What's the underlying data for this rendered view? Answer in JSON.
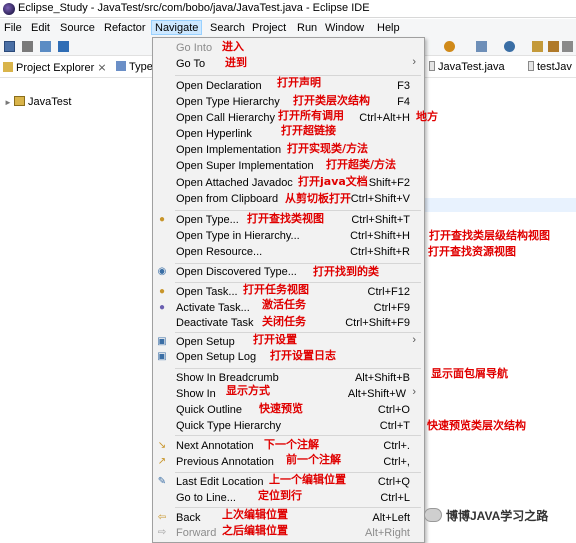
{
  "window": {
    "title": "Eclipse_Study - JavaTest/src/com/bobo/java/JavaTest.java - Eclipse IDE"
  },
  "menubar": {
    "items": [
      "File",
      "Edit",
      "Source",
      "Refactor",
      "Navigate",
      "Search",
      "Project",
      "Run",
      "Window",
      "Help"
    ]
  },
  "views": {
    "project_explorer": "Project Explorer",
    "type_hierarchy": "Type",
    "editor_tab_1": "JavaTest.java",
    "editor_tab_2": "testJav"
  },
  "tree": {
    "project": "JavaTest"
  },
  "navigate_menu": {
    "items": [
      {
        "label": "Go Into",
        "shortcut": "",
        "disabled": true,
        "annotation": "进入"
      },
      {
        "label": "Go To",
        "shortcut": "",
        "submenu": true,
        "annotation": "进到"
      },
      {
        "label": "Open Declaration",
        "shortcut": "F3",
        "annotation": "打开声明"
      },
      {
        "label": "Open Type Hierarchy",
        "shortcut": "F4",
        "annotation": "打开类层次结构"
      },
      {
        "label": "Open Call Hierarchy",
        "shortcut": "Ctrl+Alt+H",
        "annotation": "打开所有调用",
        "annotation_extra": "地方"
      },
      {
        "label": "Open Hyperlink",
        "shortcut": "",
        "annotation": "打开超链接"
      },
      {
        "label": "Open Implementation",
        "shortcut": "",
        "annotation": "打开实现类/方法"
      },
      {
        "label": "Open Super Implementation",
        "shortcut": "",
        "annotation": "打开超类/方法"
      },
      {
        "label": "Open Attached Javadoc",
        "shortcut": "Shift+F2",
        "annotation": "打开java文档"
      },
      {
        "label": "Open from Clipboard",
        "shortcut": "Ctrl+Shift+V",
        "annotation": "从剪切板打开"
      },
      {
        "label": "Open Type...",
        "shortcut": "Ctrl+Shift+T",
        "annotation": "打开查找类视图"
      },
      {
        "label": "Open Type in Hierarchy...",
        "shortcut": "Ctrl+Shift+H",
        "annotation": "打开查找类层级结构视图"
      },
      {
        "label": "Open Resource...",
        "shortcut": "Ctrl+Shift+R",
        "annotation": "打开查找资源视图"
      },
      {
        "label": "Open Discovered Type...",
        "shortcut": "",
        "annotation": "打开找到的类"
      },
      {
        "label": "Open Task...",
        "shortcut": "Ctrl+F12",
        "annotation": "打开任务视图"
      },
      {
        "label": "Activate Task...",
        "shortcut": "Ctrl+F9",
        "annotation": "激活任务"
      },
      {
        "label": "Deactivate Task",
        "shortcut": "Ctrl+Shift+F9",
        "annotation": "关闭任务"
      },
      {
        "label": "Open Setup",
        "shortcut": "",
        "submenu": true,
        "annotation": "打开设置"
      },
      {
        "label": "Open Setup Log",
        "shortcut": "",
        "annotation": "打开设置日志"
      },
      {
        "label": "Show In Breadcrumb",
        "shortcut": "Alt+Shift+B",
        "annotation": "显示面包屑导航"
      },
      {
        "label": "Show In",
        "shortcut": "Alt+Shift+W",
        "submenu": true,
        "annotation": "显示方式"
      },
      {
        "label": "Quick Outline",
        "shortcut": "Ctrl+O",
        "annotation": "快速预览"
      },
      {
        "label": "Quick Type Hierarchy",
        "shortcut": "Ctrl+T",
        "annotation": "快速预览类层次结构"
      },
      {
        "label": "Next Annotation",
        "shortcut": "Ctrl+.",
        "annotation": "下一个注解"
      },
      {
        "label": "Previous Annotation",
        "shortcut": "Ctrl+,",
        "annotation": "前一个注解"
      },
      {
        "label": "Last Edit Location",
        "shortcut": "Ctrl+Q",
        "annotation": "上一个编辑位置"
      },
      {
        "label": "Go to Line...",
        "shortcut": "Ctrl+L",
        "annotation": "定位到行"
      },
      {
        "label": "Back",
        "shortcut": "Alt+Left",
        "annotation": "上次编辑位置"
      },
      {
        "label": "Forward",
        "shortcut": "Alt+Right",
        "disabled": true,
        "annotation": "之后编辑位置"
      }
    ]
  },
  "watermark": "博博JAVA学习之路",
  "colors": {
    "menu_bg": "#f2f2f2",
    "annotation": "#e00000",
    "active_menu": "#cde8ff"
  }
}
